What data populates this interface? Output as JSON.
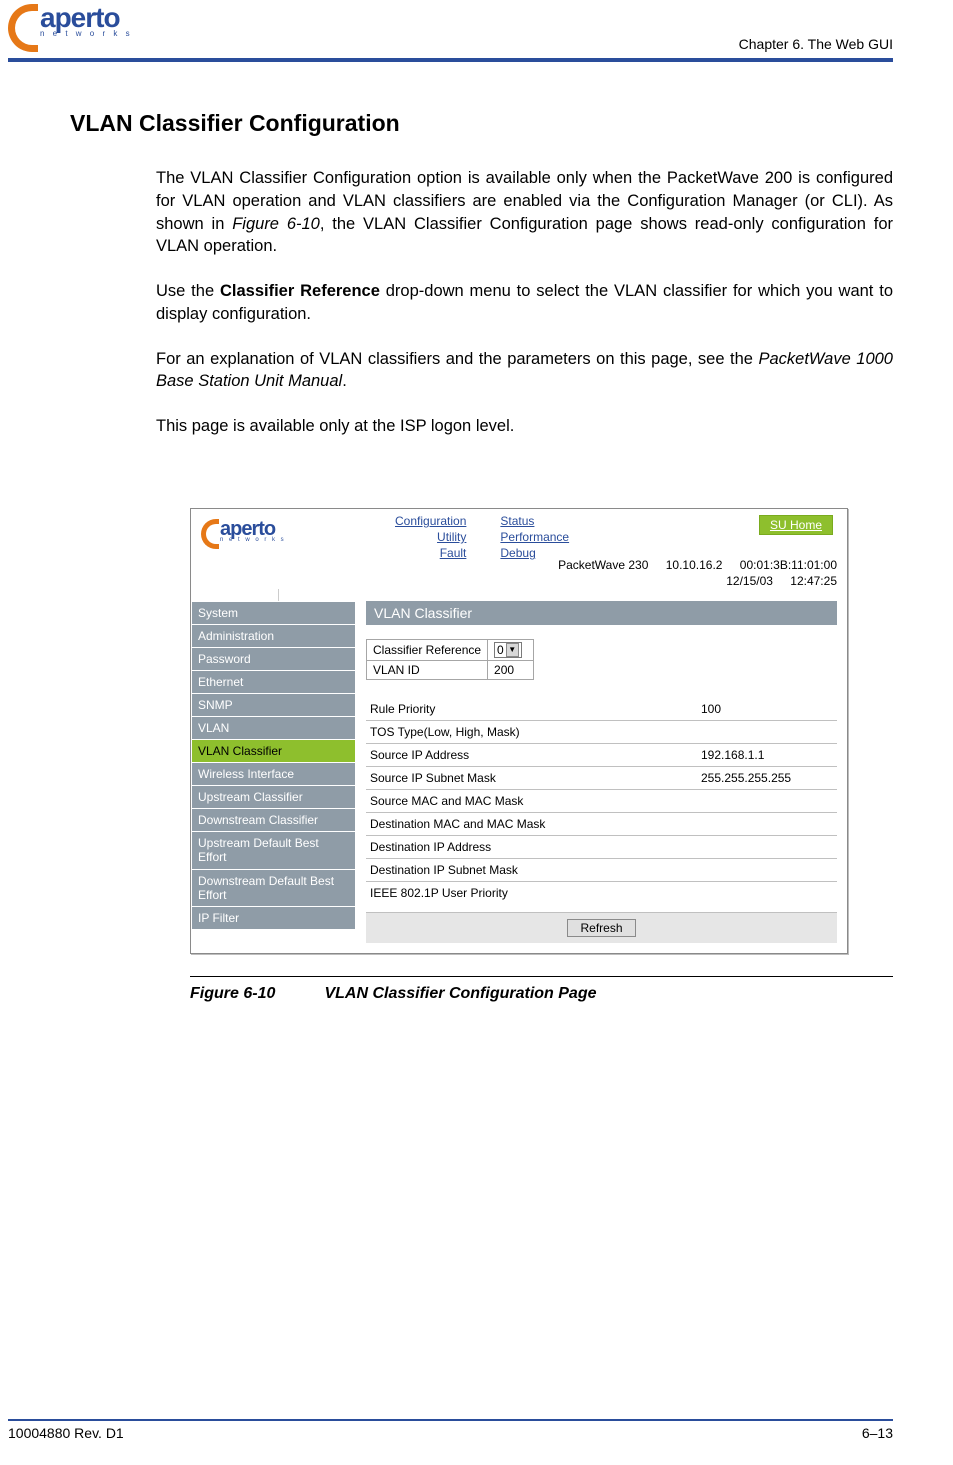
{
  "header": {
    "brand_word": "aperto",
    "brand_sub": "n e t w o r k s",
    "chapter": "Chapter 6.  The Web GUI"
  },
  "section": {
    "heading": "VLAN Classifier Configuration",
    "p1_a": "The VLAN Classifier Configuration option is available only when the PacketWave 200 is configured for VLAN operation and VLAN classifiers are enabled via the Configuration Man­ager (or CLI). As shown in ",
    "p1_ref": "Figure 6-10",
    "p1_b": ", the VLAN Classifier Configuration page shows read-only configuration for VLAN operation.",
    "p2_a": "Use the ",
    "p2_bold": "Classifier Reference",
    "p2_b": " drop-down menu to select the VLAN classifier for which you want to display configuration.",
    "p3_a": "For an explanation of VLAN classifiers and the parameters on this page, see the ",
    "p3_ref": "PacketWave 1000 Base Station Unit Manual",
    "p3_b": ".",
    "p4": "This page is available only at the ISP logon level."
  },
  "gui": {
    "brand_word": "aperto",
    "brand_sub": "n e t w o r k s",
    "nav_col1": [
      "Configuration",
      "Utility",
      "Fault"
    ],
    "nav_col2": [
      "Status",
      "Performance",
      "Debug"
    ],
    "su_home": "SU Home",
    "env_device": "PacketWave 230",
    "env_ip": "10.10.16.2",
    "env_mac": "00:01:3B:11:01:00",
    "env_date": "12/15/03",
    "env_time": "12:47:25",
    "sidebar": [
      {
        "label": "System",
        "active": false
      },
      {
        "label": "Administration",
        "active": false
      },
      {
        "label": "Password",
        "active": false
      },
      {
        "label": "Ethernet",
        "active": false
      },
      {
        "label": "SNMP",
        "active": false
      },
      {
        "label": "VLAN",
        "active": false
      },
      {
        "label": "VLAN Classifier",
        "active": true
      },
      {
        "label": "Wireless Interface",
        "active": false
      },
      {
        "label": "Upstream Classifier",
        "active": false
      },
      {
        "label": "Downstream Classifier",
        "active": false
      },
      {
        "label": "Upstream Default Best Effort",
        "active": false
      },
      {
        "label": "Downstream Default Best Effort",
        "active": false
      },
      {
        "label": "IP Filter",
        "active": false
      }
    ],
    "content_title": "VLAN Classifier",
    "ref_table": {
      "row1_label": "Classifier Reference",
      "row1_value": "0",
      "row2_label": "VLAN ID",
      "row2_value": "200"
    },
    "params": [
      {
        "label": "Rule Priority",
        "value": "100"
      },
      {
        "label": "TOS Type(Low, High, Mask)",
        "value": ""
      },
      {
        "label": "Source IP Address",
        "value": "192.168.1.1"
      },
      {
        "label": "Source IP Subnet Mask",
        "value": "255.255.255.255"
      },
      {
        "label": "Source MAC and MAC Mask",
        "value": ""
      },
      {
        "label": "Destination MAC and MAC Mask",
        "value": ""
      },
      {
        "label": "Destination IP Address",
        "value": ""
      },
      {
        "label": "Destination IP Subnet Mask",
        "value": ""
      },
      {
        "label": "IEEE 802.1P User Priority",
        "value": ""
      }
    ],
    "refresh_label": "Refresh"
  },
  "chart_data": {
    "type": "table",
    "title": "VLAN Classifier",
    "series": [
      {
        "name": "Classifier Reference",
        "values": [
          0
        ]
      },
      {
        "name": "VLAN ID",
        "values": [
          200
        ]
      },
      {
        "name": "Rule Priority",
        "values": [
          100
        ]
      },
      {
        "name": "TOS Type(Low, High, Mask)",
        "values": [
          null
        ]
      },
      {
        "name": "Source IP Address",
        "values": [
          "192.168.1.1"
        ]
      },
      {
        "name": "Source IP Subnet Mask",
        "values": [
          "255.255.255.255"
        ]
      },
      {
        "name": "Source MAC and MAC Mask",
        "values": [
          null
        ]
      },
      {
        "name": "Destination MAC and MAC Mask",
        "values": [
          null
        ]
      },
      {
        "name": "Destination IP Address",
        "values": [
          null
        ]
      },
      {
        "name": "Destination IP Subnet Mask",
        "values": [
          null
        ]
      },
      {
        "name": "IEEE 802.1P User Priority",
        "values": [
          null
        ]
      }
    ]
  },
  "figure": {
    "num": "Figure 6-10",
    "title": "VLAN Classifier Configuration Page"
  },
  "footer": {
    "left": "10004880 Rev. D1",
    "right": "6–13"
  }
}
